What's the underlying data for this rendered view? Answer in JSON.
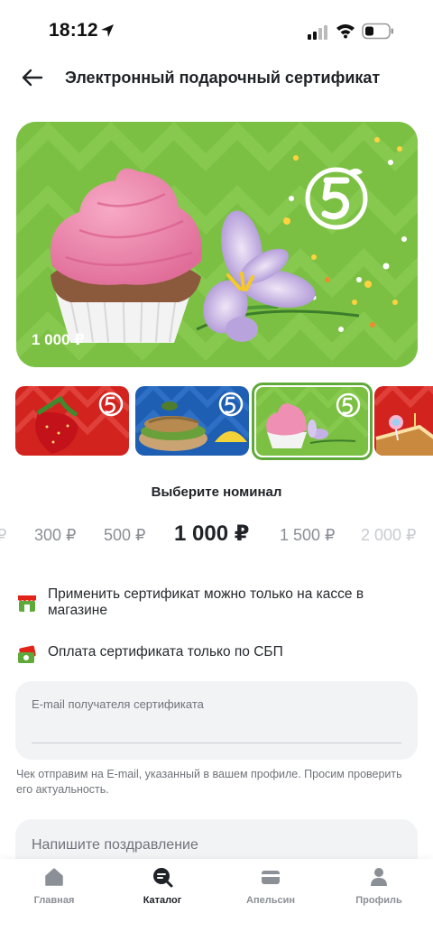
{
  "status_bar": {
    "time": "18:12"
  },
  "header": {
    "title": "Электронный подарочный сертификат"
  },
  "hero": {
    "amount": "1 000 ₽"
  },
  "thumbnails": [
    {
      "name": "strawberry"
    },
    {
      "name": "fish-sandwich"
    },
    {
      "name": "cupcake",
      "selected": true
    },
    {
      "name": "cake-lollipop"
    }
  ],
  "denomination": {
    "title": "Выберите номинал",
    "options": [
      "₽",
      "300 ₽",
      "500 ₽",
      "1 000 ₽",
      "1 500 ₽",
      "2 000 ₽"
    ],
    "selected": "1 000 ₽"
  },
  "info": {
    "store_only": "Применить сертификат можно только на кассе в магазине",
    "sbp_only": "Оплата сертификата только по СБП"
  },
  "email": {
    "label": "E-mail получателя сертификата",
    "value": "",
    "note": "Чек отправим на E-mail, указанный в вашем профиле. Просим проверить его актуальность."
  },
  "greeting": {
    "placeholder": "Напишите поздравление"
  },
  "tabbar": {
    "home": "Главная",
    "catalog": "Каталог",
    "orange": "Апельсин",
    "profile": "Профиль"
  },
  "colors": {
    "brand_green": "#7bc043",
    "selected_border": "#5fa83a",
    "brand_red": "#e2231a"
  }
}
